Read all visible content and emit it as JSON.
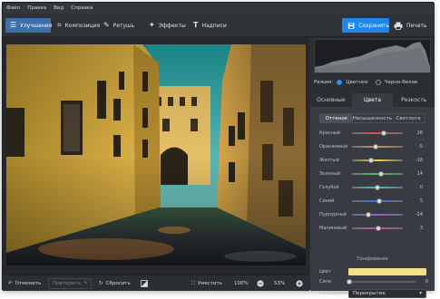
{
  "menu": [
    "Файл",
    "Правка",
    "Вид",
    "Справка"
  ],
  "toolbar": {
    "tools": [
      {
        "label": "Улучшения",
        "icon": "sliders-icon",
        "glyph": "☰"
      },
      {
        "label": "Композиция",
        "icon": "crop-icon",
        "glyph": "⌗"
      },
      {
        "label": "Ретушь",
        "icon": "brush-icon",
        "glyph": "✎"
      },
      {
        "label": "Эффекты",
        "icon": "magic-wand-icon",
        "glyph": "✦"
      },
      {
        "label": "Надписи",
        "icon": "text-icon",
        "glyph": "T"
      }
    ],
    "save_label": "Сохранить",
    "print_label": "Печать"
  },
  "bottom": {
    "undo": "Отменить",
    "redo": "Повторить",
    "reset": "Сбросить",
    "fit": "Уместить",
    "zoom_100": "100%",
    "zoom": "53%"
  },
  "panel": {
    "mode_label": "Режим:",
    "mode_color": "Цветное",
    "mode_bw": "Черно-белое",
    "tabs": [
      "Основные",
      "Цвета",
      "Резкость"
    ],
    "subtabs": [
      "Оттенок",
      "Насыщенность",
      "Светлота"
    ],
    "sliders": [
      {
        "label": "Красный",
        "value": "26",
        "pos": 0.62,
        "color": "#e05050"
      },
      {
        "label": "Оранжевый",
        "value": "-5",
        "pos": 0.47,
        "color": "#e8913a"
      },
      {
        "label": "Желтый",
        "value": "-18",
        "pos": 0.38,
        "color": "#e8d63a"
      },
      {
        "label": "Зеленый",
        "value": "14",
        "pos": 0.58,
        "color": "#58c05a"
      },
      {
        "label": "Голубой",
        "value": "0",
        "pos": 0.5,
        "color": "#45c2d6"
      },
      {
        "label": "Синий",
        "value": "5",
        "pos": 0.54,
        "color": "#3f6fd8"
      },
      {
        "label": "Пурпурный",
        "value": "-24",
        "pos": 0.33,
        "color": "#a254d4"
      },
      {
        "label": "Малиновый",
        "value": "3",
        "pos": 0.52,
        "color": "#d64a9a"
      }
    ],
    "toning_title": "Тонирование",
    "color_label": "Цвет",
    "toning_color": "#f5e08a",
    "strength_label": "Сила",
    "strength_value": "0",
    "blend_label": "Смешивание",
    "blend_value": "Перекрытие"
  }
}
